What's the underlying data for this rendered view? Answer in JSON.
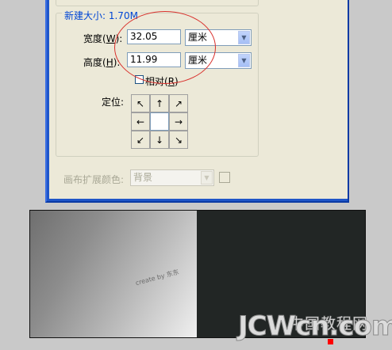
{
  "dialog": {
    "new_size_label": "新建大小: 1.70M",
    "width": {
      "label": "宽度(",
      "accel": "W",
      "label_end": "):",
      "value": "32.05",
      "unit": "厘米"
    },
    "height": {
      "label": "高度(",
      "accel": "H",
      "label_end": "):",
      "value": "11.99",
      "unit": "厘米"
    },
    "relative": {
      "label": "相对(",
      "accel": "R",
      "label_end": ")",
      "checked": false
    },
    "anchor_label": "定位:",
    "anchor_arrows": [
      "↖",
      "↑",
      "↗",
      "←",
      "",
      "→",
      "↙",
      "↓",
      "↘"
    ],
    "ext_color_label": "画布扩展颜色:",
    "ext_color_value": "背景"
  },
  "canvas": {
    "watermark": "create by 东东"
  },
  "watermark": {
    "brand": "JCWcn.com",
    "brand_cn": "中国教程网"
  },
  "colors": {
    "dialog_bg": "#ece9d8",
    "title_blue": "#1f55c8",
    "legend_blue": "#0046d5",
    "annotation_red": "#d9302c",
    "canvas_dark": "#222625"
  }
}
